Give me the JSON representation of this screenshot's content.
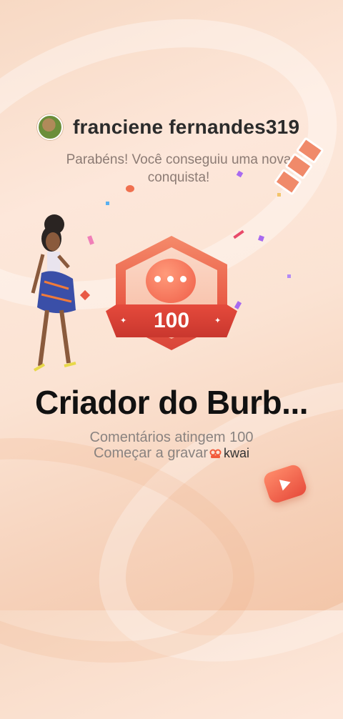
{
  "user": {
    "username": "franciene fernandes319"
  },
  "congrats_line1": "Parabéns! Você conseguiu uma nova",
  "congrats_line2": "conquista!",
  "badge": {
    "number": "100",
    "icon": "chat-bubble-icon"
  },
  "achievement": {
    "title": "Criador do Burb...",
    "description": "Comentários atingem 100",
    "record_label": "Começar a gravar",
    "brand": "kwai"
  },
  "colors": {
    "accent": "#e54a3c",
    "background": "#fde7da",
    "title": "#111111",
    "muted": "#8a8380"
  }
}
